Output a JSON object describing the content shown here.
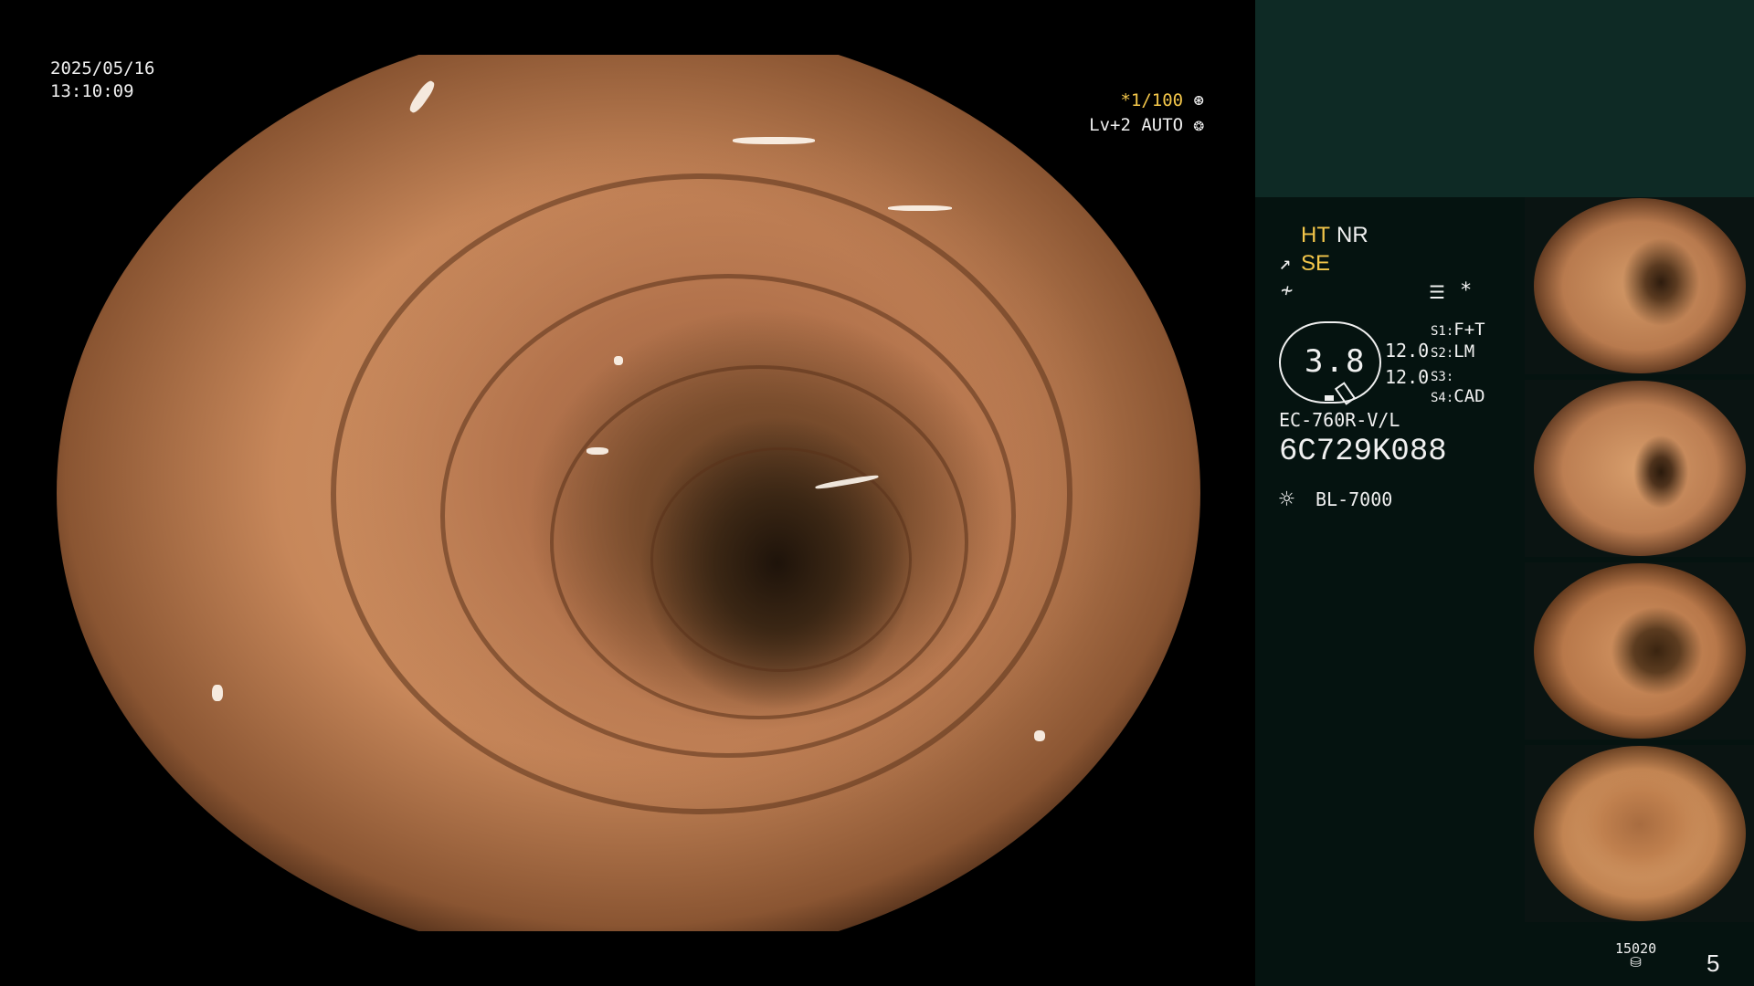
{
  "overlay": {
    "date": "2025/05/16",
    "time": "13:10:09",
    "shutter": "*1/100",
    "shutter_icon": "aperture-icon",
    "iris": "Lv+2 AUTO",
    "iris_icon": "iris-icon"
  },
  "panel": {
    "ht": "HT",
    "nr": "NR",
    "se": "SE",
    "zoom_value": "3.8",
    "value_1": "12.0",
    "value_2": "12.0",
    "switches": [
      {
        "label": "S1:",
        "value": "F+T"
      },
      {
        "label": "S2:",
        "value": "LM"
      },
      {
        "label": "S3:",
        "value": ""
      },
      {
        "label": "S4:",
        "value": "CAD"
      }
    ],
    "scope_model": "EC-760R-V/L",
    "serial": "6C729K088",
    "light_source": "BL-7000",
    "counter": "15020",
    "page": "5"
  },
  "colors": {
    "accent_yellow": "#f3c64a",
    "panel_top": "#0e2a25",
    "panel_bg": "#051310",
    "text": "#f0f0f0"
  },
  "thumbnails": [
    {
      "name": "thumbnail-1"
    },
    {
      "name": "thumbnail-2"
    },
    {
      "name": "thumbnail-3"
    },
    {
      "name": "thumbnail-4"
    }
  ]
}
